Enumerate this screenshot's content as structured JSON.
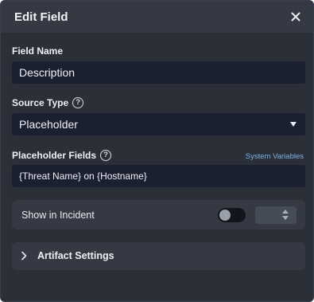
{
  "dialog": {
    "title": "Edit Field",
    "close_icon": "close-icon"
  },
  "field_name": {
    "label": "Field Name",
    "value": "Description"
  },
  "source_type": {
    "label": "Source Type",
    "help_icon": "help-icon",
    "selected": "Placeholder"
  },
  "placeholder_fields": {
    "label": "Placeholder Fields",
    "help_icon": "help-icon",
    "link": "System Variables",
    "value": "{Threat Name} on {Hostname}"
  },
  "show_in_incident": {
    "label": "Show in Incident",
    "enabled": false
  },
  "artifact_settings": {
    "label": "Artifact Settings",
    "icon": "chevron-right-icon",
    "expanded": false
  },
  "colors": {
    "background": "#2a2f38",
    "header": "#343944",
    "input": "#1b2030",
    "link": "#7fb4e8"
  }
}
